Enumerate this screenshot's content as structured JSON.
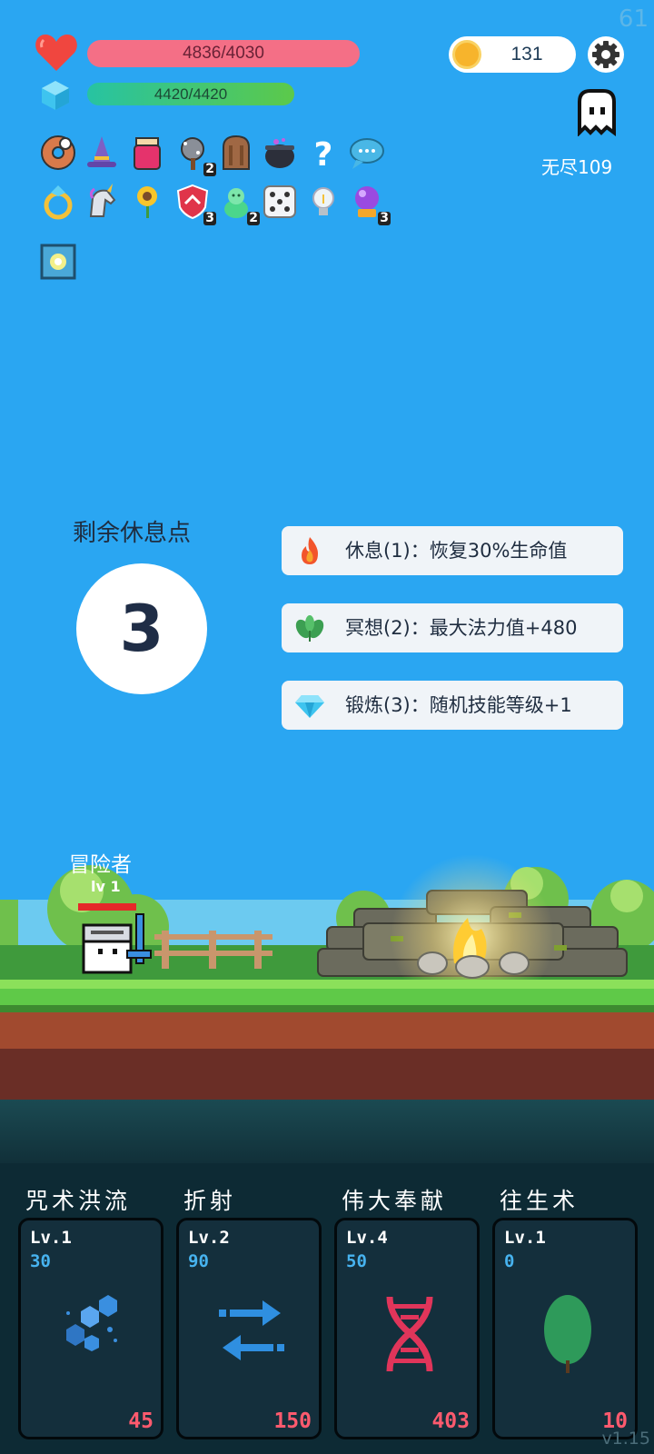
{
  "fps": "61",
  "status": {
    "hp_text": "4836/4030",
    "mp_text": "4420/4420",
    "coins": "131",
    "mode_label": "无尽109",
    "colors": {
      "hp": "#f46f86",
      "mp_start": "#27c3a2",
      "mp_end": "#5cc94a"
    }
  },
  "items": [
    {
      "icon": "donut-icon",
      "badge": ""
    },
    {
      "icon": "wizard-hat-icon",
      "badge": ""
    },
    {
      "icon": "jam-jar-icon",
      "badge": ""
    },
    {
      "icon": "spiked-club-icon",
      "badge": "2"
    },
    {
      "icon": "wooden-door-icon",
      "badge": ""
    },
    {
      "icon": "cauldron-icon",
      "badge": ""
    },
    {
      "icon": "question-mark-icon",
      "badge": ""
    },
    {
      "icon": "chat-bubble-icon",
      "badge": ""
    },
    {
      "icon": "ring-icon",
      "badge": ""
    },
    {
      "icon": "unicorn-icon",
      "badge": ""
    },
    {
      "icon": "sunflower-icon",
      "badge": ""
    },
    {
      "icon": "shield-icon",
      "badge": "3"
    },
    {
      "icon": "slime-potion-icon",
      "badge": "2"
    },
    {
      "icon": "dice-icon",
      "badge": ""
    },
    {
      "icon": "lightbulb-icon",
      "badge": ""
    },
    {
      "icon": "crystal-ball-icon",
      "badge": "3"
    },
    {
      "icon": "glowing-tile-icon",
      "badge": ""
    }
  ],
  "rest": {
    "label": "剩余休息点",
    "points": "3",
    "options": [
      {
        "icon": "fire-icon",
        "text": "休息(1)：恢复30%生命值"
      },
      {
        "icon": "herb-icon",
        "text": "冥想(2)：最大法力值+480"
      },
      {
        "icon": "diamond-icon",
        "text": "锻炼(3)：随机技能等级+1"
      }
    ]
  },
  "player": {
    "name": "冒险者",
    "level": "lv 1"
  },
  "skills": [
    {
      "name": "咒术洪流",
      "level": "Lv.1",
      "cost": "30",
      "value": "45",
      "icon": "hexagons-icon"
    },
    {
      "name": "折射",
      "level": "Lv.2",
      "cost": "90",
      "value": "150",
      "icon": "arrows-swap-icon"
    },
    {
      "name": "伟大奉献",
      "level": "Lv.4",
      "cost": "50",
      "value": "403",
      "icon": "dna-icon"
    },
    {
      "name": "往生术",
      "level": "Lv.1",
      "cost": "0",
      "value": "10",
      "icon": "leaf-icon"
    }
  ],
  "version": "v1.15"
}
